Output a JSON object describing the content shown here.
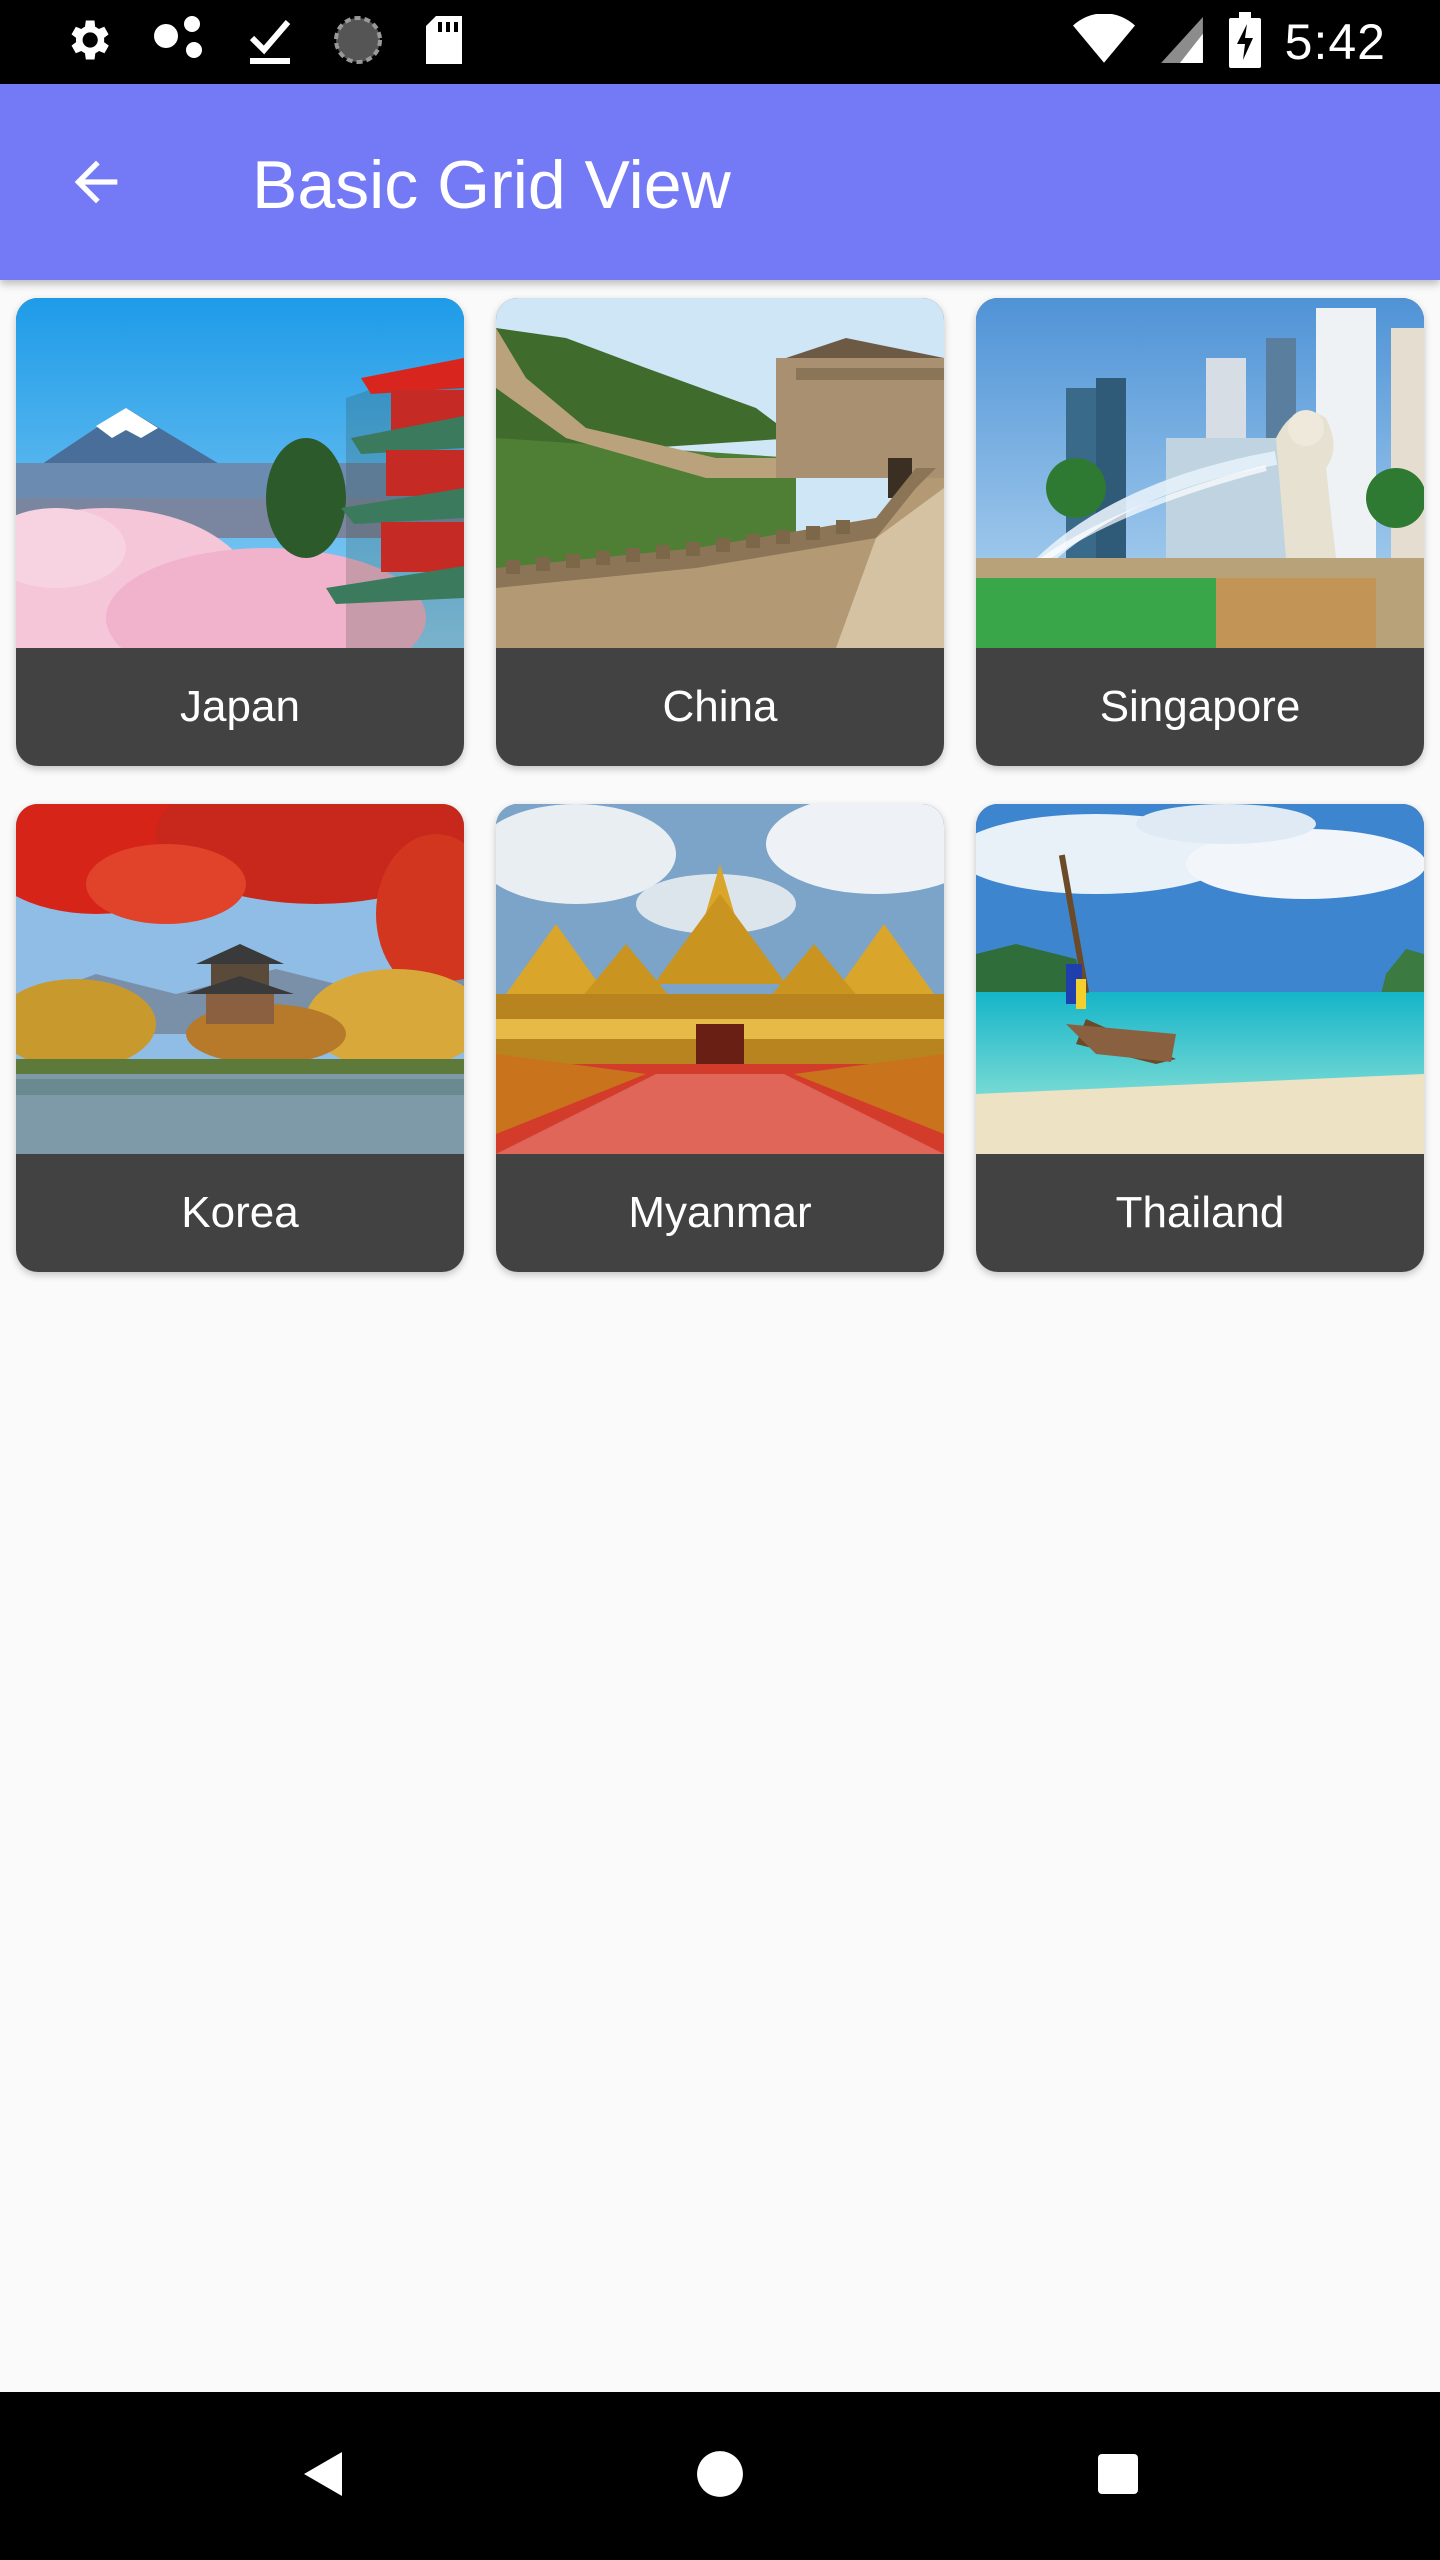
{
  "status_bar": {
    "time": "5:42",
    "left_icons": [
      "settings-icon",
      "share-dots-icon",
      "download-done-icon",
      "sync-circle-icon",
      "sd-card-icon"
    ],
    "right_icons": [
      "wifi-icon",
      "cell-signal-icon",
      "battery-charging-icon"
    ]
  },
  "app_bar": {
    "title": "Basic Grid View",
    "back_icon": "arrow-back-icon",
    "color": "#7479f5"
  },
  "grid": {
    "items": [
      {
        "label": "Japan"
      },
      {
        "label": "China"
      },
      {
        "label": "Singapore"
      },
      {
        "label": "Korea"
      },
      {
        "label": "Myanmar"
      },
      {
        "label": "Thailand"
      }
    ]
  },
  "nav_bar": {
    "buttons": [
      "back-triangle-icon",
      "home-circle-icon",
      "recents-square-icon"
    ]
  },
  "colors": {
    "card_label_bg": "#424242",
    "page_bg": "#fafafa"
  }
}
